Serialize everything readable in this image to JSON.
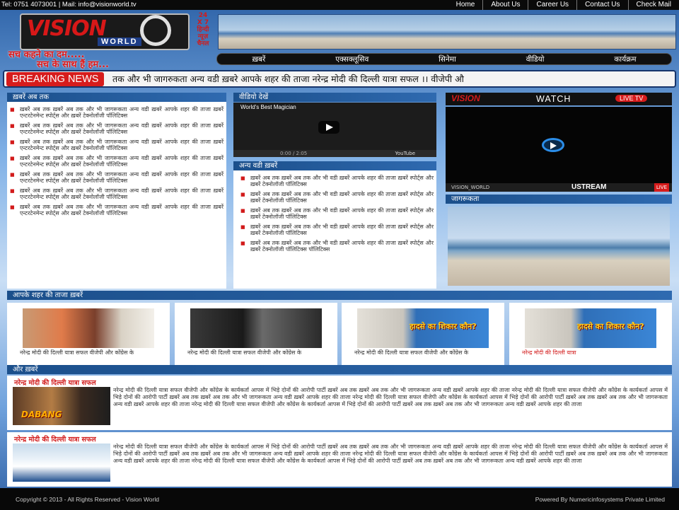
{
  "topbar": {
    "contact": "Tel: 0751 4073001 | Mail: info@visionworld.tv",
    "nav": [
      "Home",
      "About Us",
      "Career Us",
      "Contact Us",
      "Check Mail"
    ]
  },
  "logo": {
    "vision": "VISION",
    "world": "WORLD",
    "tag_247": "24 X 7 हिन्दी न्यूज़ चैनल",
    "slogan_line1": "सच कहने का दम.....",
    "slogan_line2": "सच के साथ हैं हम..."
  },
  "mainnav": [
    "ख़बरें",
    "एक्सक्लूसिव",
    "सिनेमा",
    "वीडियो",
    "कार्यक्रम"
  ],
  "ticker": {
    "label": "BREAKING NEWS",
    "text": "तक और भी जागरुकता अन्य वडी ख़बरे आपके शहर की ताजा नरेन्द्र मोदी की दिल्ली यात्रा सफल ।। वीजेपी औ"
  },
  "news_now": {
    "heading": "ख़बरें अब तक",
    "items": [
      "ख़बरें अब तक ख़बरें अब तक और भी जागरूकता अन्य वडी ख़बरें आपके शहर की ताजा ख़बरें एन्टरटेनमेन्ट स्पोर्ट्स और ख़बरें टेक्नोलॉजी पॉलिटिक्स",
      "ख़बरें अब तक ख़बरें अब तक और भी जागरूकता अन्य वडी ख़बरें आपके शहर की ताजा ख़बरें एन्टरटेनमेन्ट स्पोर्ट्स और ख़बरें टेक्नोलॉजी पॉलिटिक्स",
      "ख़बरें अब तक ख़बरें अब तक और भी जागरूकता अन्य वडी ख़बरें आपके शहर की ताजा ख़बरें एन्टरटेनमेन्ट स्पोर्ट्स और ख़बरें टेक्नोलॉजी पॉलिटिक्स",
      "ख़बरें अब तक ख़बरें अब तक और भी जागरूकता अन्य वडी ख़बरें आपके शहर की ताजा ख़बरें एन्टरटेनमेन्ट स्पोर्ट्स और ख़बरें टेक्नोलॉजी पॉलिटिक्स",
      "ख़बरें अब तक ख़बरें अब तक और भी जागरूकता अन्य वडी ख़बरें आपके शहर की ताजा ख़बरें एन्टरटेनमेन्ट स्पोर्ट्स और ख़बरें टेक्नोलॉजी पॉलिटिक्स",
      "ख़बरें अब तक ख़बरें अब तक और भी जागरूकता अन्य वडी ख़बरें आपके शहर की ताजा ख़बरें एन्टरटेनमेन्ट स्पोर्ट्स और ख़बरें टेक्नोलॉजी पॉलिटिक्स",
      "ख़बरें अब तक ख़बरें अब तक और भी जागरूकता अन्य वडी ख़बरें आपके शहर की ताजा ख़बरें एन्टरटेनमेन्ट स्पोर्ट्स और ख़बरें टेक्नोलॉजी पॉलिटिक्स"
    ]
  },
  "video_panel": {
    "heading": "वीडियो देखें",
    "video_title": "World's Best Magician",
    "time": "0:00 / 2:05",
    "brand": "YouTube"
  },
  "other_news": {
    "heading": "अन्य वडी ख़बरें",
    "items": [
      "ख़बरें अब तक ख़बरें अब तक और भी वडी ख़बरें आपके शहर की ताजा ख़बरें स्पोर्ट्स और ख़बरें टेक्नोलॉजी पॉलिटिक्स",
      "ख़बरें अब तक ख़बरें अब तक और भी वडी ख़बरें आपके शहर की ताजा ख़बरें स्पोर्ट्स और ख़बरें टेक्नोलॉजी पॉलिटिक्स",
      "ख़बरें अब तक ख़बरें अब तक और भी वडी ख़बरें आपके शहर की ताजा ख़बरें स्पोर्ट्स और ख़बरें टेक्नोलॉजी पॉलिटिक्स",
      "ख़बरें अब तक ख़बरें अब तक और भी वडी ख़बरें आपके शहर की ताजा ख़बरें स्पोर्ट्स और ख़बरें टेक्नोलॉजी पॉलिटिक्स",
      "ख़बरें अब तक ख़बरें अब तक और भी वडी ख़बरें आपके शहर की ताजा ख़बरें स्पोर्ट्स और ख़बरें टेक्नोलॉजी पॉलिटिक्स पॉलिटिक्स"
    ]
  },
  "watch": {
    "brand": "VISION",
    "watch": "WATCH",
    "live_tv": "LIVE TV",
    "channel": "VISION_WORLD",
    "ustream": "USTREAM",
    "live": "LIVE"
  },
  "awareness": {
    "heading": "जागरूकता"
  },
  "city_news": {
    "heading": "आपके शहर की ताजा ख़बरें",
    "cards": [
      {
        "caption": "नरेन्द्र मोदी की दिल्ली यात्रा सफल वीजेपी और कोंग्रेस के",
        "img_text": ""
      },
      {
        "caption": "नरेन्द्र मोदी की दिल्ली यात्रा सफल वीजेपी और कोंग्रेस के",
        "img_text": ""
      },
      {
        "caption": "नरेन्द्र मोदी की दिल्ली यात्रा सफल वीजेपी और कोंग्रेस के",
        "img_text": "हादसे का शिकार कौन?"
      },
      {
        "caption": "नरेन्द्र मोदी की दिल्ली यात्रा सफल वीजेपी और कोंग्रेस के",
        "img_text": "हादसे का शिकार कौन?",
        "highlight": "नरेन्द्र मोदी की दिल्ली यात्रा"
      }
    ]
  },
  "more_news": {
    "heading": "और ख़बरें",
    "articles": [
      {
        "title": "नरेन्द्र मोदी की दिल्ली यात्रा सफल",
        "img_text": "DABANG",
        "text": "नरेन्द्र मोदी की दिल्ली यात्रा सफल वीजेपी और कोंग्रेस के कार्यकर्ता आपस में भिड़े दोनों की आरोपी पार्टी ख़बरें अब तक ख़बरें अब तक और भी जागरूकता अन्य वडी ख़बरें आपके शहर की ताजा नरेन्द्र मोदी की दिल्ली यात्रा सफल वीजेपी और कोंग्रेस के कार्यकर्ता आपस में भिड़े दोनों की आरोपी पार्टी ख़बरें अब तक ख़बरें अब तक और भी जागरूकता अन्य वडी ख़बरें आपके शहर की ताजा नरेन्द्र मोदी की दिल्ली यात्रा सफल वीजेपी और कोंग्रेस के कार्यकर्ता आपस में भिड़े दोनों की आरोपी पार्टी ख़बरें अब तक ख़बरें अब तक और भी जागरूकता अन्य वडी ख़बरें आपके शहर की ताजा नरेन्द्र मोदी की दिल्ली यात्रा सफल वीजेपी और कोंग्रेस के कार्यकर्ता आपस में भिड़े दोनों की आरोपी पार्टी ख़बरें अब तक ख़बरें अब तक और भी जागरूकता अन्य वडी ख़बरें आपके शहर की ताजा"
      },
      {
        "title": "नरेन्द्र मोदी की दिल्ली यात्रा सफल",
        "img_text": "",
        "text": "नरेन्द्र मोदी की दिल्ली यात्रा सफल वीजेपी और कोंग्रेस के कार्यकर्ता आपस में भिड़े दोनों की आरोपी पार्टी ख़बरें अब तक ख़बरें अब तक और भी जागरूकता अन्य वडी ख़बरें आपके शहर की ताजा नरेन्द्र मोदी की दिल्ली यात्रा सफल वीजेपी और कोंग्रेस के कार्यकर्ता आपस में भिड़े दोनों की आरोपी पार्टी ख़बरें अब तक ख़बरें अब तक और भी जागरूकता अन्य वडी ख़बरें आपके शहर की ताजा नरेन्द्र मोदी की दिल्ली यात्रा सफल वीजेपी और कोंग्रेस के कार्यकर्ता आपस में भिड़े दोनों की आरोपी पार्टी ख़बरें अब तक ख़बरें अब तक और भी जागरूकता अन्य वडी ख़बरें आपके शहर की ताजा नरेन्द्र मोदी की दिल्ली यात्रा सफल वीजेपी और कोंग्रेस के कार्यकर्ता आपस में भिड़े दोनों की आरोपी पार्टी ख़बरें अब तक ख़बरें अब तक और भी जागरूकता अन्य वडी ख़बरें आपके शहर की ताजा"
      }
    ]
  },
  "footer": {
    "left": "Copyright © 2013 - All Rights Reserved - Vision World",
    "right": "Powered By Numericinfosystems Private Limited"
  },
  "colors": {
    "accent_red": "#d61c1c",
    "header_blue": "#1b4f8b",
    "page_blue": "#3f79c2",
    "bar_black": "#0a0a0a"
  }
}
